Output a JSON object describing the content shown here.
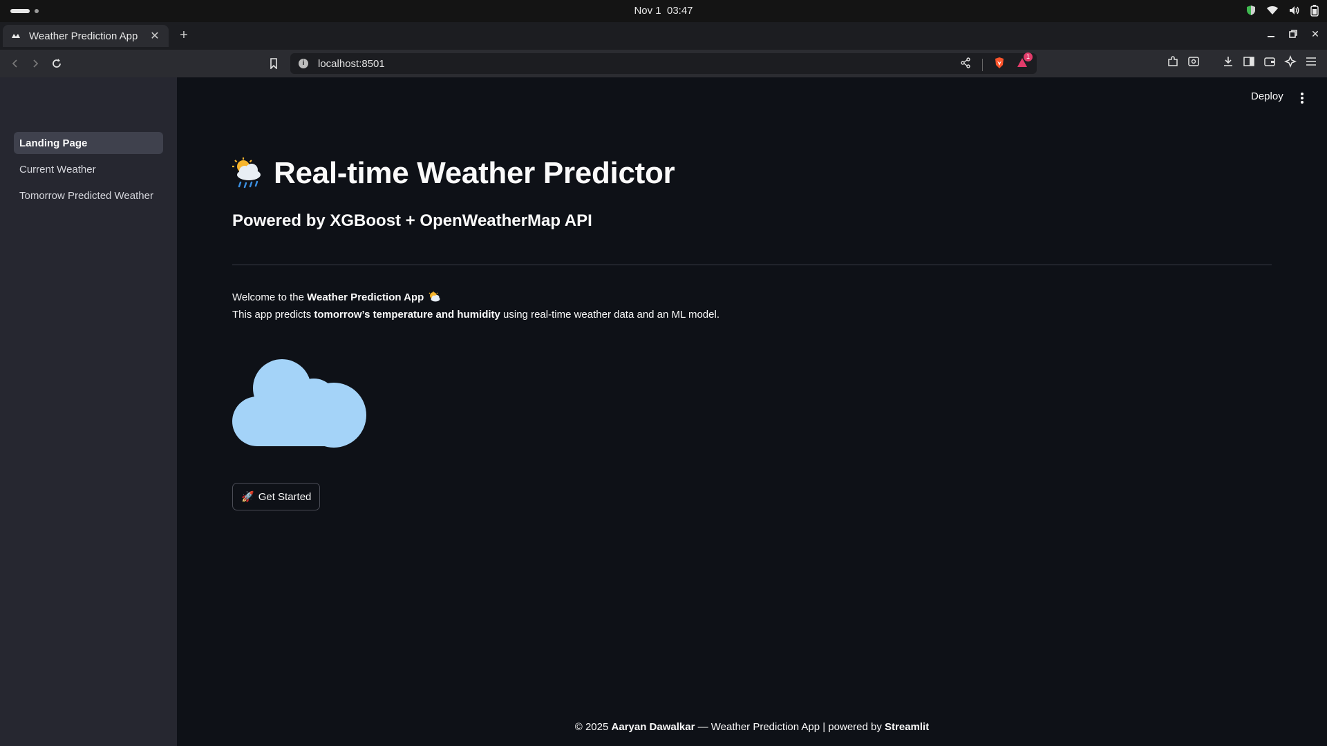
{
  "os": {
    "date": "Nov 1",
    "time": "03:47"
  },
  "browser": {
    "tab_title": "Weather Prediction App",
    "url": "localhost:8501",
    "brave_badge_count": "1"
  },
  "sidebar": {
    "items": [
      {
        "label": "Landing Page",
        "active": true
      },
      {
        "label": "Current Weather",
        "active": false
      },
      {
        "label": "Tomorrow Predicted Weather",
        "active": false
      }
    ]
  },
  "header": {
    "deploy_label": "Deploy"
  },
  "main": {
    "title": "Real-time Weather Predictor",
    "subtitle": "Powered by XGBoost + OpenWeatherMap API",
    "welcome_prefix": "Welcome to the ",
    "welcome_bold": "Weather Prediction App",
    "desc_prefix": "This app predicts ",
    "desc_bold": "tomorrow’s temperature and humidity",
    "desc_suffix": " using real-time weather data and an ML model.",
    "button_label": "Get Started",
    "button_emoji": "🚀"
  },
  "footer": {
    "prefix": "© 2025 ",
    "author": "Aaryan Dawalkar",
    "middle": " — Weather Prediction App | powered by ",
    "brand": "Streamlit"
  },
  "colors": {
    "background": "#0e1117",
    "sidebar": "#262730",
    "cloud": "#a4d3f8",
    "text": "#fafafa"
  }
}
